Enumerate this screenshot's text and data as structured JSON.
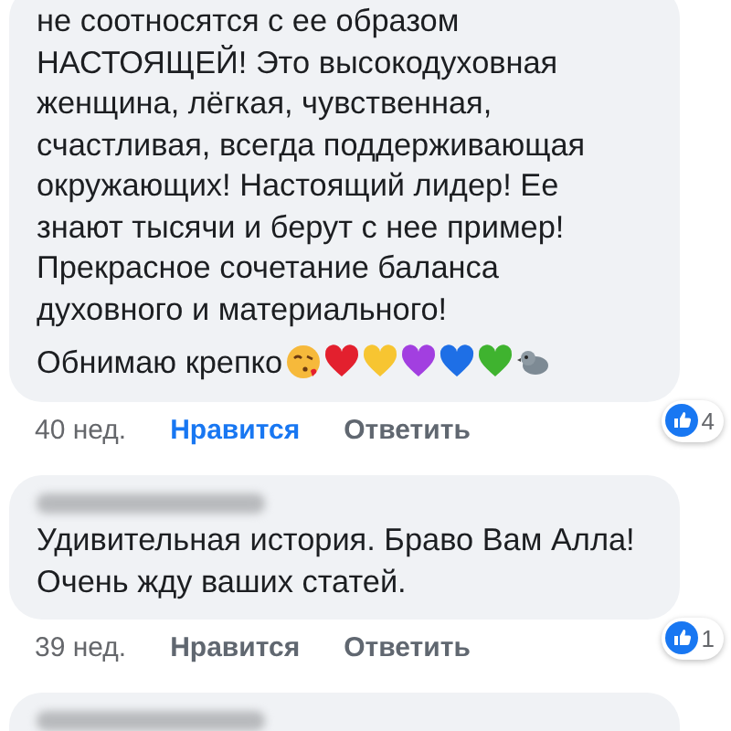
{
  "comments": [
    {
      "text": "не соотносятся с ее образом НАСТОЯЩЕЙ! Это высокодуховная женщина, лёгкая, чувственная, счастливая, всегда поддерживающая окружающих! Настоящий лидер! Ее знают тысячи и берут с нее пример! Прекрасное сочетание баланса духовного и материального!",
      "closing": "Обнимаю крепко",
      "emojis": [
        {
          "kind": "kiss"
        },
        {
          "kind": "heart",
          "color": "#e3202e"
        },
        {
          "kind": "heart",
          "color": "#f7c531"
        },
        {
          "kind": "heart",
          "color": "#a23fe0"
        },
        {
          "kind": "heart",
          "color": "#1e6fe6"
        },
        {
          "kind": "heart",
          "color": "#3fb32f"
        },
        {
          "kind": "bird"
        }
      ],
      "time": "40 нед.",
      "like": "Нравится",
      "liked": true,
      "reply": "Ответить",
      "reactions": "4"
    },
    {
      "author_blurred": true,
      "text": "Удивительная история. Браво Вам Алла! Очень жду ваших статей.",
      "time": "39 нед.",
      "like": "Нравится",
      "liked": false,
      "reply": "Ответить",
      "reactions": "1"
    },
    {
      "author_blurred": true
    }
  ]
}
